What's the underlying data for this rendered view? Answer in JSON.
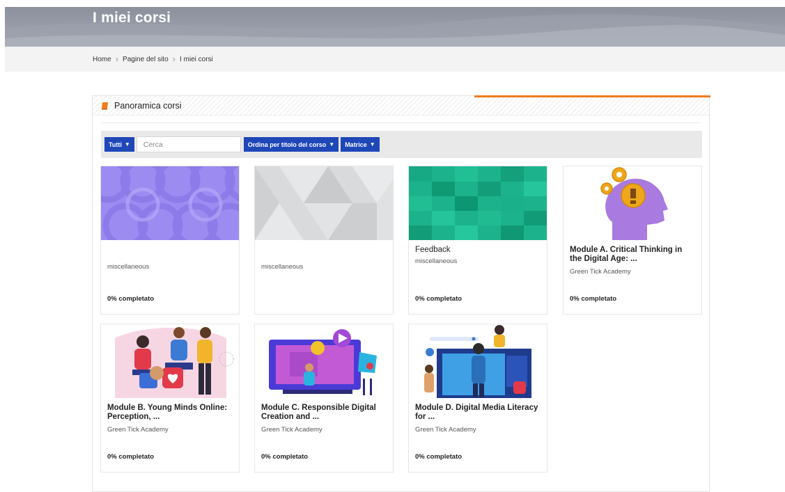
{
  "header": {
    "title": "I miei corsi"
  },
  "breadcrumb": [
    "Home",
    "Pagine del sito",
    "I miei corsi"
  ],
  "panel": {
    "title": "Panoramica corsi",
    "icon": "book-icon",
    "accent_color": "#f07c1f"
  },
  "filters": {
    "grouping": "Tutti",
    "search_placeholder": "Cerca",
    "sort": "Ordina per titolo del corso",
    "view": "Matrice",
    "button_color": "#1f47b8"
  },
  "courses": [
    {
      "name": "",
      "category": "miscellaneous",
      "progress": "0% completato",
      "image": "pattern-circles-purple"
    },
    {
      "name": "",
      "category": "miscellaneous",
      "progress": "",
      "image": "pattern-triangles-gray"
    },
    {
      "name": "Feedback",
      "category": "miscellaneous",
      "progress": "0% completato",
      "image": "pattern-squares-green"
    },
    {
      "name": "Module A. Critical Thinking in the Digital Age: ...",
      "category": "Green Tick Academy",
      "progress": "0% completato",
      "image": "head-gears-illustration"
    },
    {
      "name": "Module B. Young Minds Online: Perception, ...",
      "category": "Green Tick Academy",
      "progress": "0% completato",
      "image": "social-media-people-illustration"
    },
    {
      "name": "Module C. Responsible Digital Creation and ...",
      "category": "Green Tick Academy",
      "progress": "0% completato",
      "image": "digital-creation-illustration"
    },
    {
      "name": "Module D. Digital Media Literacy for ...",
      "category": "Green Tick Academy",
      "progress": "0% completato",
      "image": "media-literacy-illustration"
    }
  ]
}
